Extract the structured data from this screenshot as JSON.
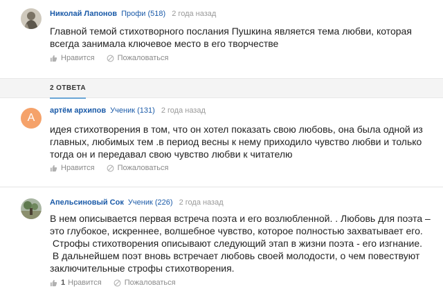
{
  "question": {
    "author": "Николай Лапонов",
    "rank": "Профи (518)",
    "when": "2 года назад",
    "text": "Главной темой стихотворного послания Пушкина является тема любви, которая\nвсегда занимала ключевое место в его творчестве",
    "like_label": "Нравится",
    "complain_label": "Пожаловаться"
  },
  "answers_tab": "2 ОТВЕТА",
  "answers": [
    {
      "avatar_letter": "А",
      "author": "артём архипов",
      "rank": "Ученик (131)",
      "when": "2 года назад",
      "text": "идея стихотворения в том, что он хотел показать свою любовь, она была одной из\nглавных, любимых тем .в период весны к нему приходило чувство любви и только\nтогда он и передавал свою чувство любви к читателю",
      "like_label": "Нравится",
      "complain_label": "Пожаловаться"
    },
    {
      "author": "Апельсиновый Сок",
      "rank": "Ученик (226)",
      "when": "2 года назад",
      "text": "В нем описывается первая встреча поэта и его возлюбленной. . Любовь для поэта –\nэто глубокое, искреннее, волшебное чувство, которое полностью захватывает его.\n Строфы стихотворения описывают следующий этап в жизни поэта - его изгнание.\n В дальнейшем поэт вновь встречает любовь своей молодости, о чем повествуют\nзаключительные строфы стихотворения.",
      "likes": "1",
      "like_label": "Нравится",
      "complain_label": "Пожаловаться"
    }
  ],
  "colors": {
    "link": "#1a5aa8",
    "muted": "#999999",
    "avatar_orange": "#f5a26a",
    "tab_underline": "#6aa6d6"
  }
}
